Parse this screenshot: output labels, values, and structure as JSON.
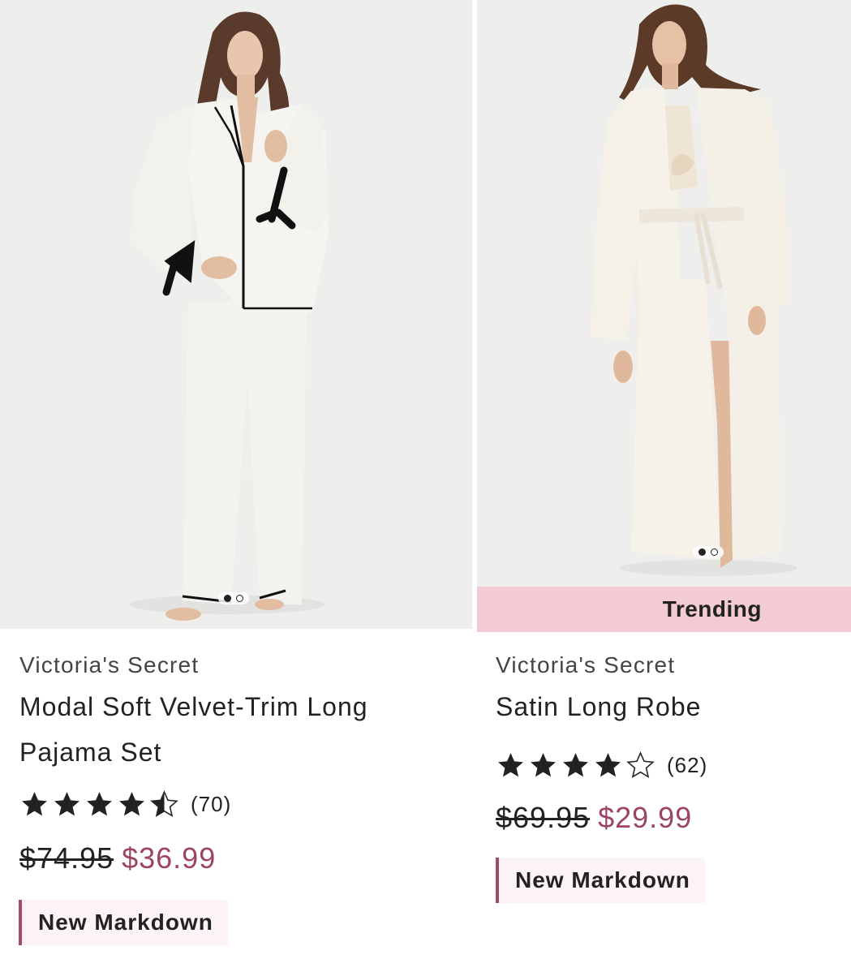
{
  "products": [
    {
      "brand": "Victoria's Secret",
      "title_line1": "Modal Soft Velvet-Trim Long",
      "title_line2": "Pajama Set",
      "rating": 4.5,
      "review_count": "(70)",
      "old_price": "$74.95",
      "sale_price": "$36.99",
      "tag": "New Markdown",
      "image_slides": 2,
      "active_slide": 1
    },
    {
      "badge": "Trending",
      "brand": "Victoria's Secret",
      "title_line1": "Satin Long Robe",
      "rating": 4,
      "review_count": "(62)",
      "old_price": "$69.95",
      "sale_price": "$29.99",
      "tag": "New Markdown",
      "image_slides": 2,
      "active_slide": 1
    }
  ],
  "colors": {
    "sale_price": "#9b4468",
    "badge_bg": "#f3cbd3",
    "tag_bg": "#fbf3f4",
    "tag_accent": "#a04c6a",
    "image_bg": "#eeefed"
  },
  "icons": {
    "star_full": "star-filled-icon",
    "star_half": "star-half-icon",
    "star_empty": "star-outline-icon"
  }
}
